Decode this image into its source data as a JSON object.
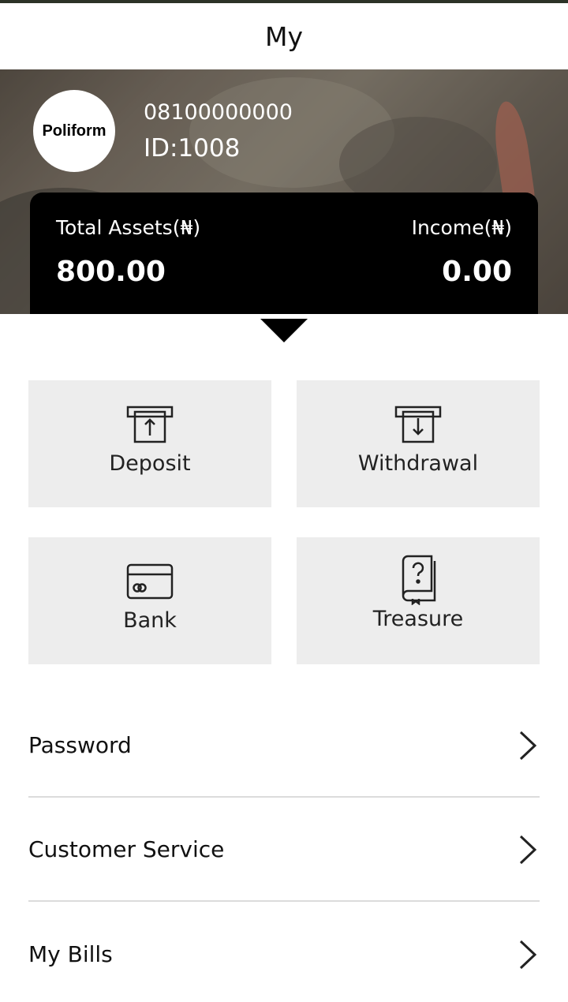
{
  "header": {
    "title": "My"
  },
  "profile": {
    "avatar_text": "Poliform",
    "phone": "08100000000",
    "id_text": "ID:1008"
  },
  "assets": {
    "total_label": "Total Assets(₦)",
    "total_value": "800.00",
    "income_label": "Income(₦)",
    "income_value": "0.00"
  },
  "actions": [
    {
      "label": "Deposit",
      "icon": "deposit-icon"
    },
    {
      "label": "Withdrawal",
      "icon": "withdrawal-icon"
    },
    {
      "label": "Bank",
      "icon": "bank-card-icon"
    },
    {
      "label": "Treasure",
      "icon": "treasure-book-icon"
    }
  ],
  "menu": [
    {
      "label": "Password"
    },
    {
      "label": "Customer Service"
    },
    {
      "label": "My Bills"
    }
  ],
  "colors": {
    "card_bg": "#000000",
    "tile_bg": "#ededed",
    "divider": "#dcdcdc"
  }
}
